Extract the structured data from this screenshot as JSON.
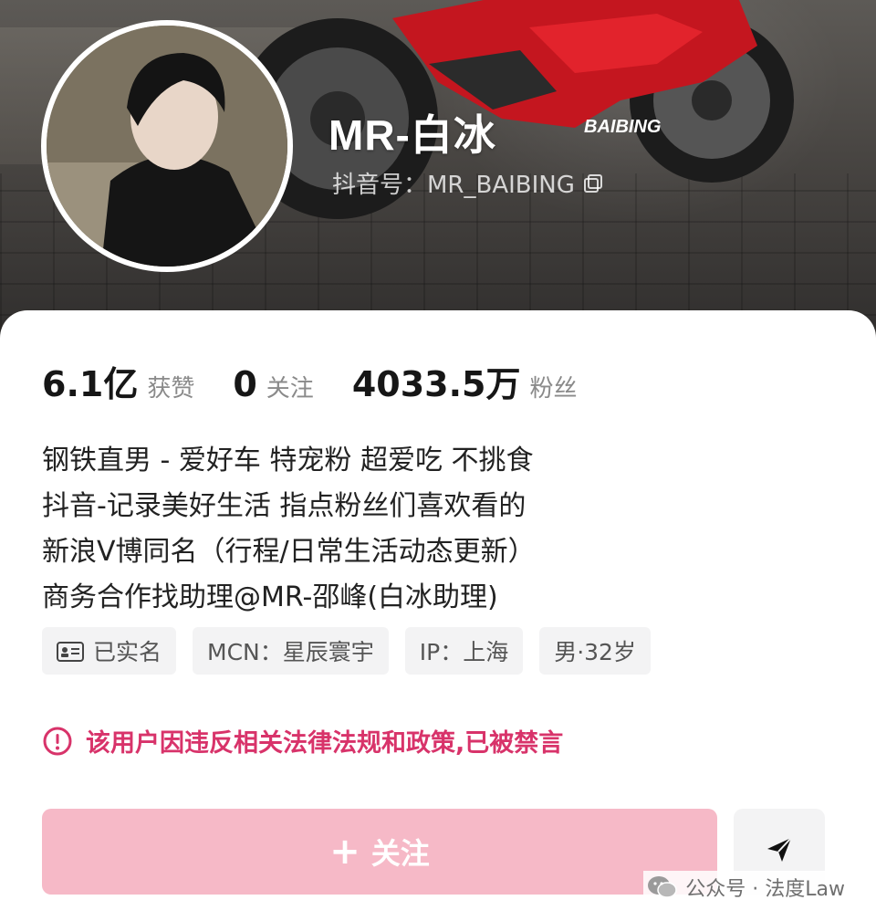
{
  "profile": {
    "nickname": "MR-白冰",
    "douyin_id": "抖音号：MR_BAIBING",
    "cover_brand_text": "BAIBING"
  },
  "stats": [
    {
      "value": "6.1亿",
      "label": "获赞"
    },
    {
      "value": "0",
      "label": "关注"
    },
    {
      "value": "4033.5万",
      "label": "粉丝"
    }
  ],
  "bio": [
    "钢铁直男 - 爱好车 特宠粉 超爱吃 不挑食",
    "抖音-记录美好生活 指点粉丝们喜欢看的",
    "新浪V博同名（行程/日常生活动态更新）",
    "商务合作找助理@MR-邵峰(白冰助理)"
  ],
  "tags": {
    "verified": "已实名",
    "mcn": "MCN：星辰寰宇",
    "ip": "IP：上海",
    "gender_age": "男·32岁"
  },
  "notice": "该用户因违反相关法律法规和政策,已被禁言",
  "actions": {
    "follow_label": "关注",
    "follow_icon": "plus-icon",
    "share_icon": "paper-plane-icon"
  },
  "watermark": {
    "text": "公众号 · 法度Law",
    "icon": "wechat-icon"
  },
  "colors": {
    "accent_pink": "#f6b9c7",
    "warning_red": "#d8336a"
  }
}
